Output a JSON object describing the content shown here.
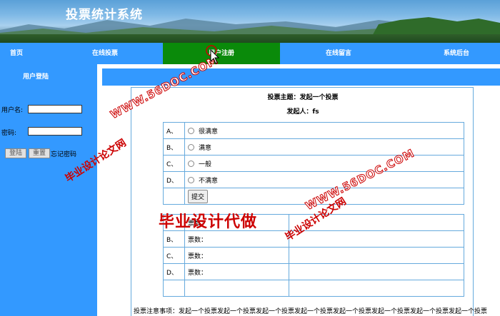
{
  "banner": {
    "title": "投票统计系统"
  },
  "nav": {
    "items": [
      {
        "label": "首页"
      },
      {
        "label": "在线投票"
      },
      {
        "label": "用户注册"
      },
      {
        "label": "在线留言"
      },
      {
        "label": "系统后台"
      }
    ]
  },
  "sidebar": {
    "title": "用户登陆",
    "username_label": "用户名:",
    "password_label": "密码:",
    "username_value": "",
    "password_value": "",
    "login_button": "登陆",
    "reset_button": "重置",
    "forgot_link": "忘记密码"
  },
  "vote": {
    "subject": "投票主题：发起一个投票",
    "initiator": "发起人：fs",
    "options": [
      {
        "letter": "A、",
        "text": "很满意"
      },
      {
        "letter": "B、",
        "text": "满意"
      },
      {
        "letter": "C、",
        "text": "一般"
      },
      {
        "letter": "D、",
        "text": "不满意"
      }
    ],
    "submit_label": "提交",
    "results": [
      {
        "letter": "",
        "label": "票数："
      },
      {
        "letter": "B、",
        "label": "票数："
      },
      {
        "letter": "C、",
        "label": "票数："
      },
      {
        "letter": "D、",
        "label": "票数："
      }
    ],
    "notice": "投票注意事项：发起一个投票发起一个投票发起一个投票发起一个投票发起一个投票发起一个投票发起一个投票发起一个投票"
  },
  "watermarks": {
    "site1": "WWW.56DOC.COM",
    "cn1": "毕业设计论文网",
    "site2": "WWW.56DOC.COM",
    "cn2": "毕业设计论文网",
    "stamp": "毕业设计代做"
  },
  "colors": {
    "nav_bg": "#3399ff",
    "nav_active": "#0a8a0a",
    "watermark": "#cc0000"
  }
}
